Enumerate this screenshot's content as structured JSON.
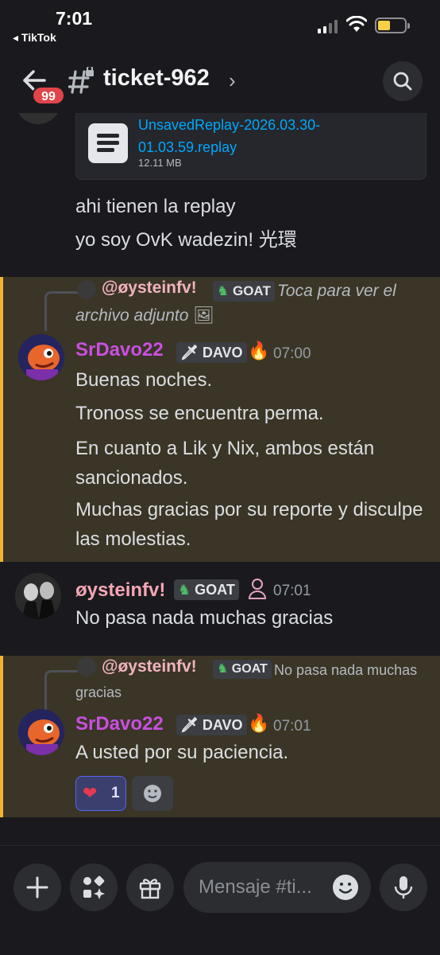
{
  "status_bar": {
    "time": "7:01",
    "back_app": "◂ TikTok"
  },
  "header": {
    "unread_badge": "99",
    "channel_name": "ticket-962",
    "chevron": "›"
  },
  "attachment": {
    "file_name": "UnsavedReplay-2026.03.30-01.03.59.replay",
    "file_size": "12.11 MB"
  },
  "messages": [
    {
      "text": "ahi tienen la replay"
    },
    {
      "text": "yo soy OvK wadezin! 光環"
    }
  ],
  "reply1": {
    "reply_author": "@øysteinfv!",
    "reply_tag": "GOAT",
    "reply_preview": "Toca para ver el archivo adjunto",
    "author": "SrDavo22",
    "author_tag": "DAVO",
    "time": "07:00",
    "lines": [
      "Buenas noches.",
      "Tronoss se encuentra perma.",
      "En cuanto a Lik y Nix, ambos están sancionados.",
      "Muchas gracias por su reporte y disculpe las molestias."
    ]
  },
  "msg2": {
    "author": "øysteinfv!",
    "author_tag": "GOAT",
    "time": "07:01",
    "text": "No pasa nada muchas gracias"
  },
  "reply2": {
    "reply_author": "@øysteinfv!",
    "reply_tag": "GOAT",
    "reply_preview": "No pasa nada muchas gracias",
    "author": "SrDavo22",
    "author_tag": "DAVO",
    "time": "07:01",
    "text": "A usted por su paciencia.",
    "reaction_count": "1"
  },
  "composer": {
    "placeholder": "Mensaje #ti..."
  },
  "colors": {
    "highlight": "#3a3526",
    "highlight_border": "#f0b232",
    "link": "#00a8fc",
    "mention_author": "#c94fe0",
    "badge": "#e1454a"
  }
}
